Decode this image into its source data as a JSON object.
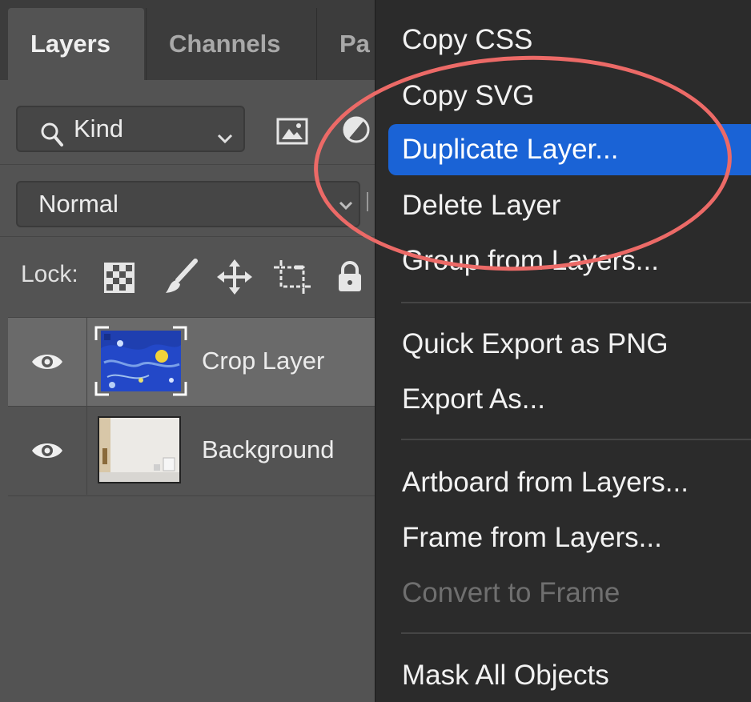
{
  "layers_panel": {
    "tabs": [
      "Layers",
      "Channels",
      "Pa"
    ],
    "filter": {
      "kind_label": "Kind"
    },
    "blend_mode": "Normal",
    "lock_label": "Lock:",
    "icons": {
      "search": "search-icon",
      "image_filter": "image-filter-icon",
      "adjustment_filter": "adjustment-filter-icon",
      "lock_transparent": "checkerboard-icon",
      "lock_pixels": "brush-icon",
      "lock_position": "move-icon",
      "lock_artboard": "artboard-icon",
      "lock_all": "lock-icon",
      "visibility": "eye-icon"
    },
    "layers": [
      {
        "name": "Crop Layer",
        "selected": true
      },
      {
        "name": "Background",
        "selected": false
      }
    ]
  },
  "context_menu": {
    "items": [
      {
        "label": "Copy CSS"
      },
      {
        "label": "Copy SVG"
      },
      {
        "label": "Duplicate Layer...",
        "highlighted": true
      },
      {
        "label": "Delete Layer"
      },
      {
        "label": "Group from Layers..."
      },
      {
        "label": "Quick Export as PNG"
      },
      {
        "label": "Export As..."
      },
      {
        "label": "Artboard from Layers..."
      },
      {
        "label": "Frame from Layers..."
      },
      {
        "label": "Convert to Frame",
        "disabled": true
      },
      {
        "label": "Mask All Objects"
      }
    ]
  },
  "colors": {
    "panel_bg": "#535353",
    "menu_bg": "#2b2b2b",
    "highlight": "#1a63d6",
    "annotation_ring": "#ec6a67"
  }
}
